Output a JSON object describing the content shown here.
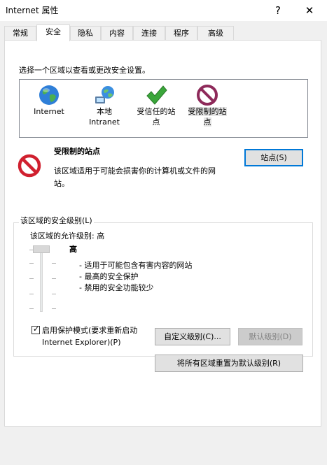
{
  "window": {
    "title": "Internet 属性",
    "help_label": "?",
    "close_label": "✕"
  },
  "tabs": [
    {
      "label": "常规"
    },
    {
      "label": "安全"
    },
    {
      "label": "隐私"
    },
    {
      "label": "内容"
    },
    {
      "label": "连接"
    },
    {
      "label": "程序"
    },
    {
      "label": "高级"
    }
  ],
  "security": {
    "instruction": "选择一个区域以查看或更改安全设置。",
    "zones": [
      {
        "line1": "Internet",
        "line2": "",
        "icon": "globe-icon"
      },
      {
        "line1": "本地",
        "line2": "Intranet",
        "icon": "intranet-icon"
      },
      {
        "line1": "受信任的站",
        "line2": "点",
        "icon": "trusted-check-icon"
      },
      {
        "line1": "受限制的站",
        "line2": "点",
        "icon": "restricted-icon"
      }
    ],
    "selected_zone": {
      "title": "受限制的站点",
      "description_line1": "该区域适用于可能会损害你的计算机或文件的网",
      "description_line2": "站。",
      "sites_button": "站点(S)"
    },
    "level_group": {
      "title": "该区域的安全级别(L)",
      "allowed_level": "该区域的允许级别: 高",
      "level_name": "高",
      "bullets": [
        "- 适用于可能包含有害内容的网站",
        "- 最高的安全保护",
        "- 禁用的安全功能较少"
      ],
      "protected_mode_line1": "启用保护模式(要求重新启动",
      "protected_mode_line2": "Internet Explorer)(P)",
      "protected_mode_checked": true,
      "custom_level_button": "自定义级别(C)...",
      "default_level_button": "默认级别(D)"
    },
    "reset_all_button": "将所有区域重置为默认级别(R)"
  },
  "colors": {
    "accent": "#0078d7",
    "restricted_red": "#d0202f",
    "trusted_green": "#3aa63a"
  }
}
